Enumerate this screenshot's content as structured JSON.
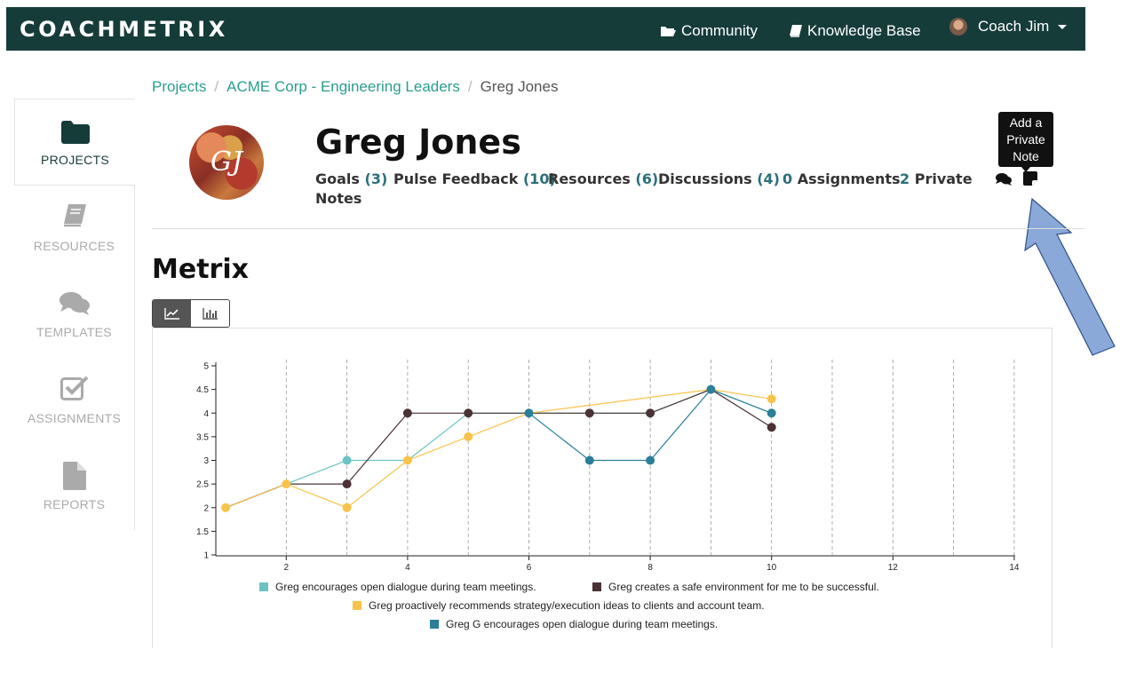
{
  "header": {
    "logo": "COACHMETRIX",
    "community": "Community",
    "knowledge_base": "Knowledge Base",
    "user": "Coach Jim"
  },
  "breadcrumb": [
    "Projects",
    "ACME Corp - Engineering Leaders",
    "Greg Jones"
  ],
  "sidebar": {
    "items": [
      {
        "label": "PROJECTS",
        "icon": "folder-icon"
      },
      {
        "label": "RESOURCES",
        "icon": "book-icon"
      },
      {
        "label": "TEMPLATES",
        "icon": "comments-icon"
      },
      {
        "label": "ASSIGNMENTS",
        "icon": "check-square-icon"
      },
      {
        "label": "REPORTS",
        "icon": "file-icon"
      }
    ]
  },
  "profile": {
    "name": "Greg Jones",
    "initials": "GJ",
    "tabs": {
      "goals": {
        "label": "Goals",
        "count": "(3)"
      },
      "pulse": {
        "label": "Pulse Feedback",
        "count": "(10)"
      },
      "resources": {
        "label": "Resources",
        "count": "(6)"
      },
      "discussions": {
        "label": "Discussions",
        "count": "(4)"
      },
      "assignments": {
        "num": "0",
        "label": "Assignments"
      },
      "private_notes": {
        "num": "2",
        "label_line1": "Private",
        "label_line2": "Notes"
      }
    }
  },
  "tooltip": {
    "line1": "Add a",
    "line2": "Private",
    "line3": "Note"
  },
  "section_title": "Metrix",
  "colors": {
    "header": "#163c3a",
    "link": "#2a9d8f",
    "s1": "#6cc3c3",
    "s2": "#4a3236",
    "s3": "#f8c34a",
    "s4": "#2b7f98"
  },
  "chart_data": {
    "type": "line",
    "xlim": [
      1,
      14
    ],
    "ylim": [
      1,
      5
    ],
    "xticks": [
      2,
      4,
      6,
      8,
      10,
      12,
      14
    ],
    "yticks": [
      1,
      1.5,
      2,
      2.5,
      3,
      3.5,
      4,
      4.5,
      5
    ],
    "grid": "vertical-dashed",
    "legend_position": "bottom",
    "series": [
      {
        "name": "Greg encourages open dialogue during team meetings.",
        "color": "#6cc3c3",
        "x": [
          1,
          2,
          3,
          4,
          5,
          6,
          7,
          8,
          9,
          10
        ],
        "y": [
          2,
          2.5,
          3,
          3,
          4,
          4,
          4,
          4,
          4.5,
          4
        ],
        "markers": [
          3
        ]
      },
      {
        "name": "Greg creates a safe environment for me to be successful.",
        "color": "#4a3236",
        "x": [
          1,
          2,
          3,
          4,
          5,
          6,
          7,
          8,
          9,
          10
        ],
        "y": [
          2,
          2.5,
          2.5,
          4,
          4,
          4,
          4,
          4,
          4.5,
          3.7
        ],
        "markers": [
          3,
          4,
          5,
          7,
          8,
          10
        ]
      },
      {
        "name": "Greg proactively recommends strategy/execution ideas to clients and account team.",
        "color": "#f8c34a",
        "x": [
          1,
          2,
          3,
          4,
          5,
          6,
          9,
          10
        ],
        "y": [
          2,
          2.5,
          2,
          3,
          3.5,
          4,
          4.5,
          4.3
        ],
        "markers": [
          1,
          2,
          3,
          4,
          5,
          10
        ]
      },
      {
        "name": "Greg G encourages open dialogue during team meetings.",
        "color": "#2b7f98",
        "x": [
          6,
          7,
          8,
          9,
          10
        ],
        "y": [
          4,
          3,
          3,
          4.5,
          4
        ],
        "markers": [
          6,
          7,
          8,
          9,
          10
        ]
      }
    ]
  }
}
